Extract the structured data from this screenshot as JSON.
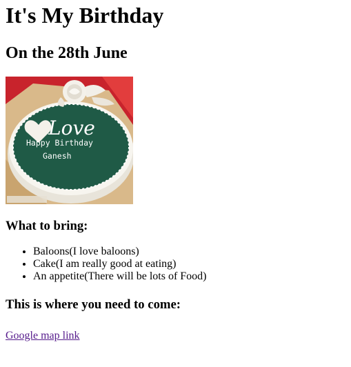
{
  "page": {
    "title": "It's My Birthday",
    "subtitle": "On the 28th June"
  },
  "cake_image": {
    "description": "Green birthday cake",
    "written": [
      "Love",
      "Happy Birthday",
      "Ganesh"
    ],
    "colors": {
      "icing": "#1f5a46",
      "cream": "#f4f1ea",
      "tablecloth": "#c8232c"
    }
  },
  "bring_section": {
    "heading": "What to bring:",
    "items": [
      "Baloons(I love baloons)",
      "Cake(I am really good at eating)",
      "An appetite(There will be lots of Food)"
    ]
  },
  "location_section": {
    "heading": "This is where you need to come:",
    "link_text": "Google map link"
  },
  "colors": {
    "visited_link": "#551a8b"
  }
}
